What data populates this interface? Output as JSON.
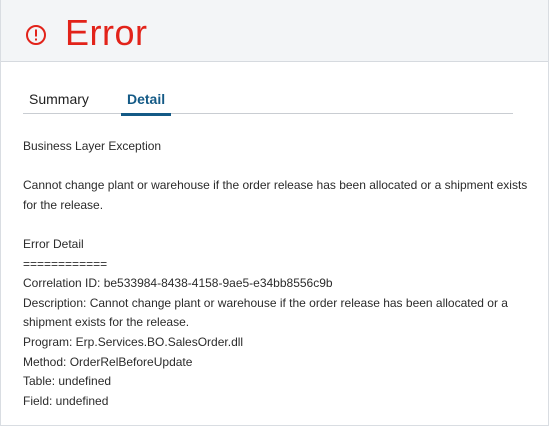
{
  "header": {
    "title": "Error",
    "icon": "error-circle-icon",
    "title_color": "#e2231a"
  },
  "tabs": [
    {
      "label": "Summary",
      "active": false
    },
    {
      "label": "Detail",
      "active": true
    }
  ],
  "detail": {
    "exception_type": "Business Layer Exception",
    "message": "Cannot change plant or warehouse if the order release has been allocated or a shipment exists for the release.",
    "section_title": "Error Detail",
    "separator": "============",
    "correlation_id": "Correlation ID: be533984-8438-4158-9ae5-e34bb8556c9b",
    "description": "Description: Cannot change plant or warehouse if the order release has been allocated or a shipment exists for the release.",
    "program": "Program: Erp.Services.BO.SalesOrder.dll",
    "method": "Method: OrderRelBeforeUpdate",
    "table": "Table: undefined",
    "field": "Field: undefined"
  },
  "colors": {
    "accent": "#145a86",
    "error": "#e2231a",
    "header_bg": "#f3f5f7"
  }
}
